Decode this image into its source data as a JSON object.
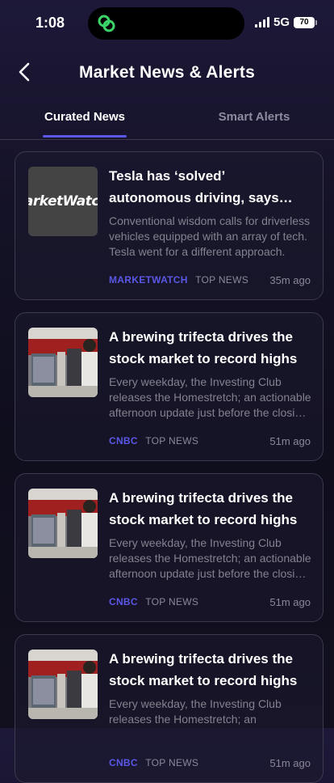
{
  "status": {
    "time": "1:08",
    "network": "5G",
    "battery": "70"
  },
  "header": {
    "title": "Market News & Alerts"
  },
  "tabs": [
    {
      "label": "Curated News",
      "active": true
    },
    {
      "label": "Smart Alerts",
      "active": false
    }
  ],
  "news": [
    {
      "thumb_text": "MarketWatch",
      "headline": "Tesla has ‘solved’ autonomous driving, says Elon Musk",
      "summary": "Conventional wisdom calls for driverless vehicles equipped with an array of tech. Tesla went for a different approach.",
      "source": "MARKETWATCH",
      "category": "TOP NEWS",
      "age": "35m ago"
    },
    {
      "headline": "A brewing trifecta drives the stock market to record highs",
      "summary": "Every weekday, the Investing Club releases the Homestretch; an actionable afternoon update just before the closing bell.",
      "source": "CNBC",
      "category": "TOP NEWS",
      "age": "51m ago"
    },
    {
      "headline": "A brewing trifecta drives the stock market to record highs",
      "summary": "Every weekday, the Investing Club releases the Homestretch; an actionable afternoon update just before the closing bell.",
      "source": "CNBC",
      "category": "TOP NEWS",
      "age": "51m ago"
    },
    {
      "headline": "A brewing trifecta drives the stock market to record highs",
      "summary": "Every weekday, the Investing Club releases the Homestretch; an",
      "source": "CNBC",
      "category": "TOP NEWS",
      "age": "51m ago"
    }
  ],
  "colors": {
    "accent": "#5b57e6",
    "island_icon": "#3ad46a"
  }
}
